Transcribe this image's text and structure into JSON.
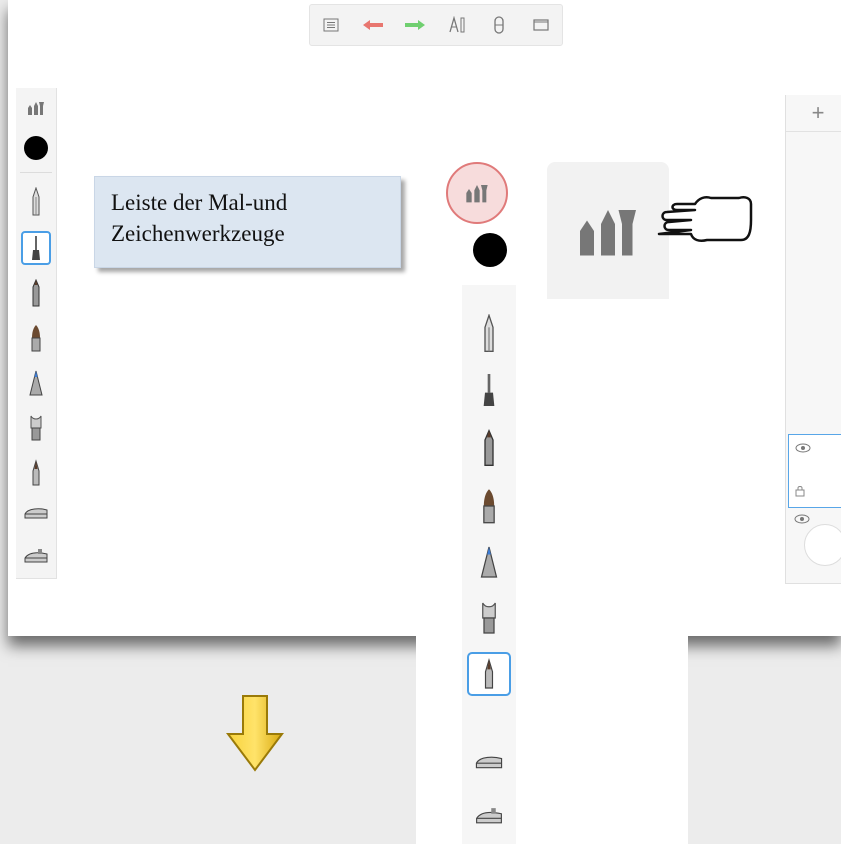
{
  "topbar": {
    "icons": [
      "list-icon",
      "undo-arrow-icon",
      "redo-arrow-icon",
      "ruler-tools-icon",
      "symmetry-icon",
      "fullscreen-icon"
    ],
    "undo_color": "#e8766f",
    "redo_color": "#6fcf6f"
  },
  "left_toolbar": {
    "icons": [
      "brush-library-icon",
      "color-swatch-icon",
      "pencil-icon",
      "ballpoint-pen-icon",
      "marker-icon",
      "paint-brush-icon",
      "airbrush-icon",
      "smudge-icon",
      "fine-brush-icon",
      "eraser-icon",
      "fill-icon"
    ],
    "selected_index": 3,
    "color": "#000000"
  },
  "callout": {
    "line1": "Leiste der Mal-und",
    "line2": "Zeichenwerkzeuge"
  },
  "right_panel": {
    "add_label": "+",
    "icons": [
      "visibility-eye-icon",
      "layer-lock-icon",
      "visibility-eye-icon"
    ]
  },
  "zoom_panel": {
    "icons": [
      "brush-library-icon",
      "color-swatch-icon",
      "pencil-icon",
      "ballpoint-pen-icon",
      "marker-icon",
      "paint-brush-icon",
      "airbrush-icon",
      "smudge-icon",
      "fine-brush-icon",
      "eraser-icon",
      "fill-icon"
    ],
    "selected_index": 8,
    "highlight_color": "#e07a7a",
    "selection_color": "#4a9ee6"
  },
  "annotations": {
    "down_arrow_color": "#f2c318",
    "pointer": "pointing-hand-icon"
  }
}
